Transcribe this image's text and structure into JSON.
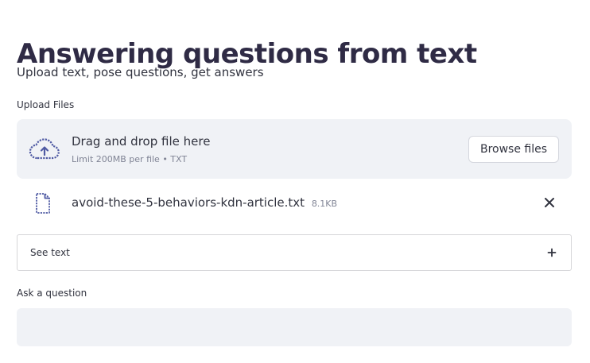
{
  "page": {
    "title": "Answering questions from text",
    "subtitle": "Upload text, pose questions, get answers"
  },
  "uploader": {
    "label": "Upload Files",
    "drop_title": "Drag and drop file here",
    "limit_text": "Limit 200MB per file • TXT",
    "browse_label": "Browse files",
    "icon": "cloud-upload-icon"
  },
  "uploaded_file": {
    "name": "avoid-these-5-behaviors-kdn-article.txt",
    "size": "8.1KB",
    "icon": "file-icon",
    "remove_icon": "close-icon"
  },
  "expander": {
    "label": "See text",
    "icon": "plus-icon"
  },
  "question": {
    "label": "Ask a question",
    "value": "",
    "placeholder": ""
  },
  "colors": {
    "title": "#2f2b45",
    "text": "#31333f",
    "muted": "#808495",
    "widget_bg": "#f0f2f6",
    "icon_blue": "#4f5aa3",
    "border": "#d6d6d9"
  }
}
